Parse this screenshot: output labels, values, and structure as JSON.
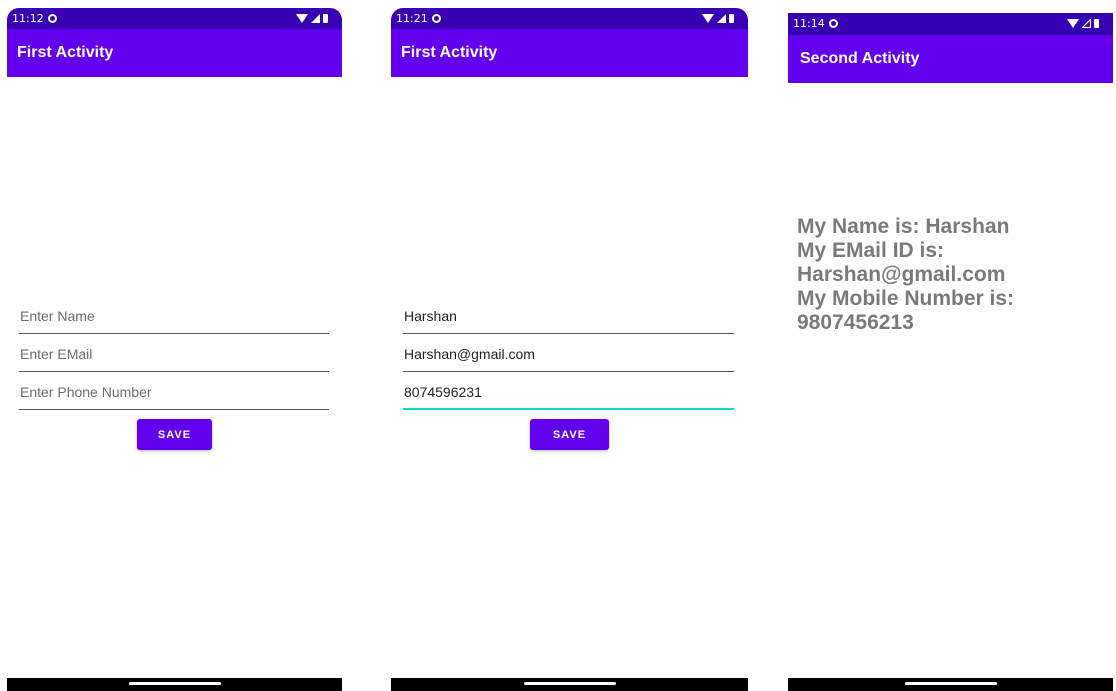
{
  "screens": [
    {
      "status_time": "11:12",
      "app_title": "First Activity",
      "fields": [
        {
          "placeholder": "Enter Name",
          "value": ""
        },
        {
          "placeholder": "Enter EMail",
          "value": ""
        },
        {
          "placeholder": "Enter Phone Number",
          "value": ""
        }
      ],
      "save_label": "SAVE"
    },
    {
      "status_time": "11:21",
      "app_title": "First Activity",
      "fields": [
        {
          "placeholder": "Enter Name",
          "value": "Harshan"
        },
        {
          "placeholder": "Enter EMail",
          "value": "Harshan@gmail.com"
        },
        {
          "placeholder": "Enter Phone Number",
          "value": "8074596231"
        }
      ],
      "save_label": "SAVE"
    },
    {
      "status_time": "11:14",
      "app_title": "Second Activity",
      "result_text": "My Name is: Harshan\nMy EMail ID is:\nHarshan@gmail.com\nMy Mobile Number is:\n9807456213"
    }
  ],
  "colors": {
    "status_bar": "#3700b3",
    "app_bar": "#6200ee",
    "button": "#6200ee",
    "focus_underline": "#03dac5",
    "result_text": "#7a7a7a"
  },
  "icons": [
    "settings-gear-icon",
    "wifi-icon",
    "cellular-signal-icon",
    "battery-icon"
  ]
}
